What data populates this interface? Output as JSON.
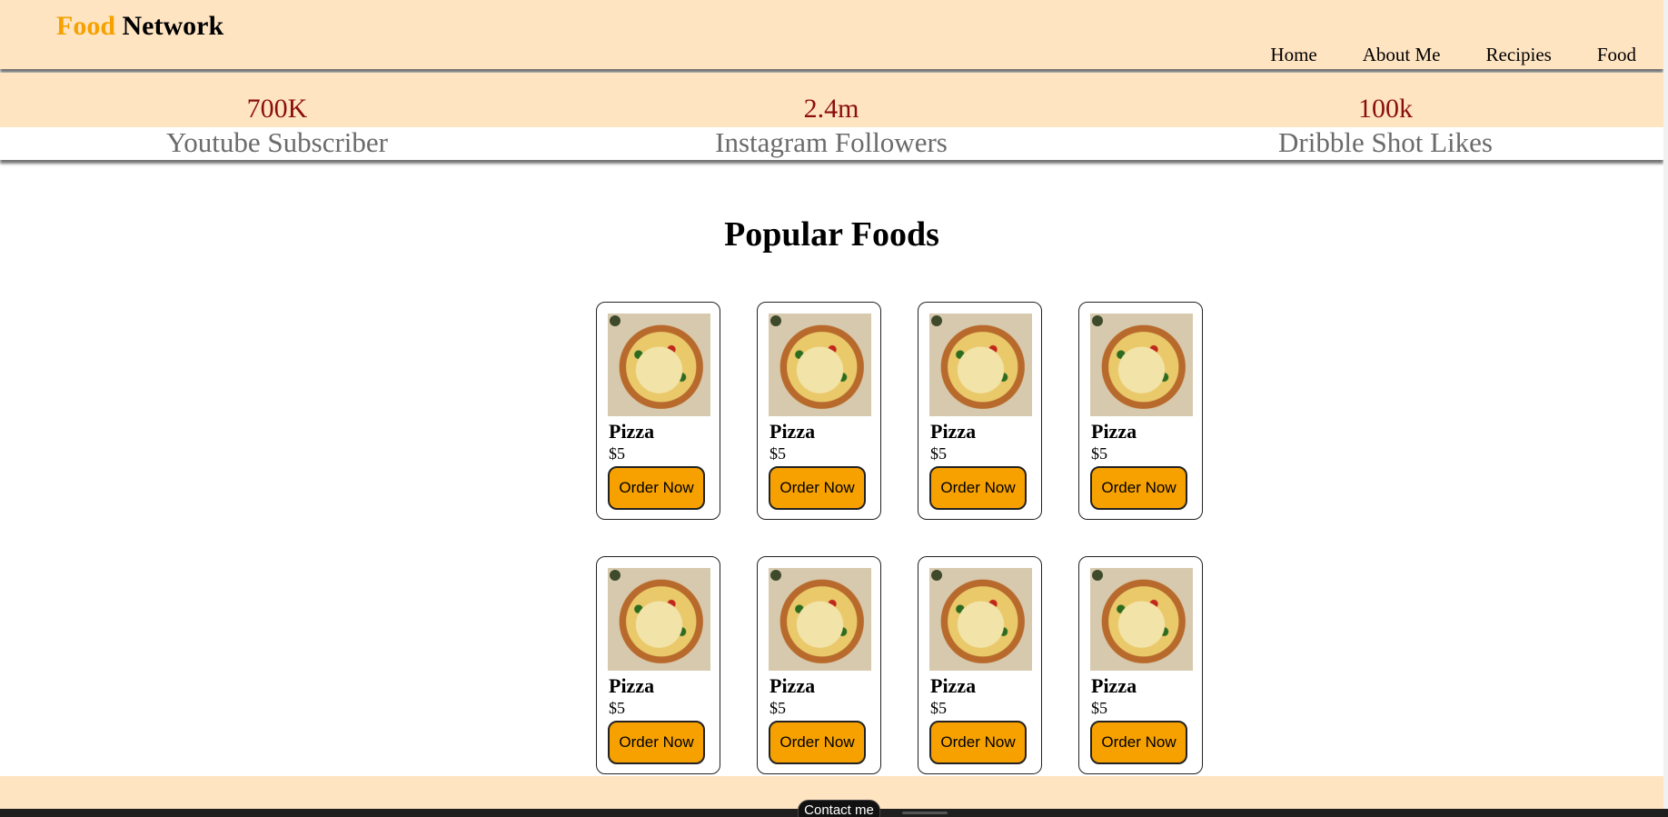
{
  "header": {
    "logo_accent": "Food",
    "logo_main": "Network",
    "nav": [
      "Home",
      "About Me",
      "Recipies",
      "Food"
    ]
  },
  "stats": [
    {
      "value": "700K",
      "label": "Youtube Subscriber"
    },
    {
      "value": "2.4m",
      "label": "Instagram Followers"
    },
    {
      "value": "100k",
      "label": "Dribble Shot Likes"
    }
  ],
  "section_title": "Popular Foods",
  "cards": [
    {
      "name": "Pizza",
      "price": "$5",
      "button": "Order Now",
      "image_icon": "pizza-image"
    },
    {
      "name": "Pizza",
      "price": "$5",
      "button": "Order Now",
      "image_icon": "pizza-image"
    },
    {
      "name": "Pizza",
      "price": "$5",
      "button": "Order Now",
      "image_icon": "pizza-image"
    },
    {
      "name": "Pizza",
      "price": "$5",
      "button": "Order Now",
      "image_icon": "pizza-image"
    },
    {
      "name": "Pizza",
      "price": "$5",
      "button": "Order Now",
      "image_icon": "pizza-image"
    },
    {
      "name": "Pizza",
      "price": "$5",
      "button": "Order Now",
      "image_icon": "pizza-image"
    },
    {
      "name": "Pizza",
      "price": "$5",
      "button": "Order Now",
      "image_icon": "pizza-image"
    },
    {
      "name": "Pizza",
      "price": "$5",
      "button": "Order Now",
      "image_icon": "pizza-image"
    }
  ],
  "footer": {
    "contact_label": "Contact me"
  },
  "colors": {
    "header_bg": "#ffe4c2",
    "accent": "#f6a100",
    "stat_number": "#8b0e0e",
    "stat_label": "#6b6b6b",
    "button_bg": "#f6a100"
  }
}
